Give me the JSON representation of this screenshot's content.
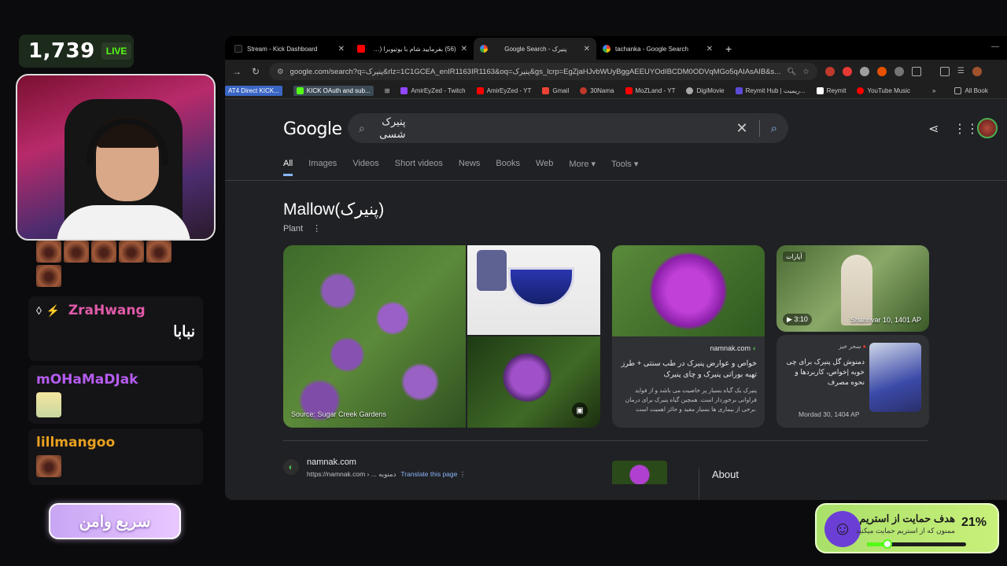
{
  "stream": {
    "viewer_count": "1,739",
    "live_label": "LIVE",
    "chat": [
      {
        "name": "ZraHwang",
        "name_color": "#e05aa8",
        "text": "نبابا"
      },
      {
        "name": "mOHaMaDJak",
        "name_color": "#b55cf0",
        "text": ""
      },
      {
        "name": "lillmangoo",
        "name_color": "#e8a020",
        "text": ""
      }
    ],
    "sub_button": "سریع وامن",
    "goal": {
      "title": "هدف حمایت از استریم",
      "subtitle": "ممنون که از استریم حمایت میکنید",
      "percent_label": "21%",
      "progress": 0.21
    }
  },
  "browser": {
    "tabs": [
      {
        "label": "Stream - Kick Dashboard",
        "favicon_color": "#000000"
      },
      {
        "label": "(56) بفرمایید شام با یوتیوبرا (سری",
        "favicon_color": "#ff0000"
      },
      {
        "label": "Google Search - پنیرک",
        "favicon_color": "#4285f4"
      },
      {
        "label": "tachanka - Google Search",
        "favicon_color": "#4285f4"
      }
    ],
    "url": "google.com/search?q=پنیرک&rlz=1C1GCEA_enIR1163IR1163&oq=پنیرک&gs_lcrp=EgZjaHJvbWUyBggAEEUYOdIBCDM0ODVqMGo5qAIAsAIB&s...",
    "bookmarks": [
      {
        "label": "AT4 Direct KICK...",
        "style": "hl"
      },
      {
        "label": "KICK OAuth and sub...",
        "style": "hl2"
      },
      {
        "label": "AmirEyZed - Twitch",
        "color": "#9146ff"
      },
      {
        "label": "AmirEyZed - YT",
        "color": "#ff0000"
      },
      {
        "label": "Gmail",
        "color": "#ea4335"
      },
      {
        "label": "30Nama",
        "color": "#c0392b"
      },
      {
        "label": "MoZLand - YT",
        "color": "#ff0000"
      },
      {
        "label": "DigiMovie",
        "color": "#aaaaaa"
      },
      {
        "label": "Reymit Hub | ریمیت...",
        "color": "#5b4bd6"
      },
      {
        "label": "Reymit",
        "color": "#ffffff"
      },
      {
        "label": "YouTube Music",
        "color": "#ff0000"
      },
      {
        "label": "All Book",
        "color": "#aaaaaa"
      }
    ]
  },
  "google": {
    "logo": "Google",
    "query": "پنیرک شسی",
    "tabs": [
      "All",
      "Images",
      "Videos",
      "Short videos",
      "News",
      "Books",
      "Web",
      "More",
      "Tools"
    ],
    "kp_title": "Mallow(پنیرک)",
    "kp_subtitle": "Plant",
    "image_source": "Source: Sugar Creek Gardens",
    "card1": {
      "site": "namnak.com",
      "title": "خواص و عوارض پنیرک در طب سنتی + طرز تهیه بوراتی پنیرک و چای پنیرک",
      "desc": "پنیرک یک گیاه بسیار پر خاصیت می باشد و از فواید فراوانی برخوردار است. همچین گیاه پنیرک برای درمان برخی از بیماری ها بسیار مفید و حائز اهمیت است."
    },
    "card2": {
      "label": "آپارات",
      "duration": "3:10",
      "date": "Shahrivar 10, 1401 AP"
    },
    "card3": {
      "source": "سحر خیز",
      "title": "دمنوش گل پنیرک برای چی خوبه |خواص، کاربردها و نحوه مصرف",
      "date": "Mordad 30, 1404 AP"
    },
    "result": {
      "site": "namnak.com",
      "url": "https://namnak.com › ... دمنوبه",
      "translate": "Translate this page"
    },
    "about": "About"
  }
}
